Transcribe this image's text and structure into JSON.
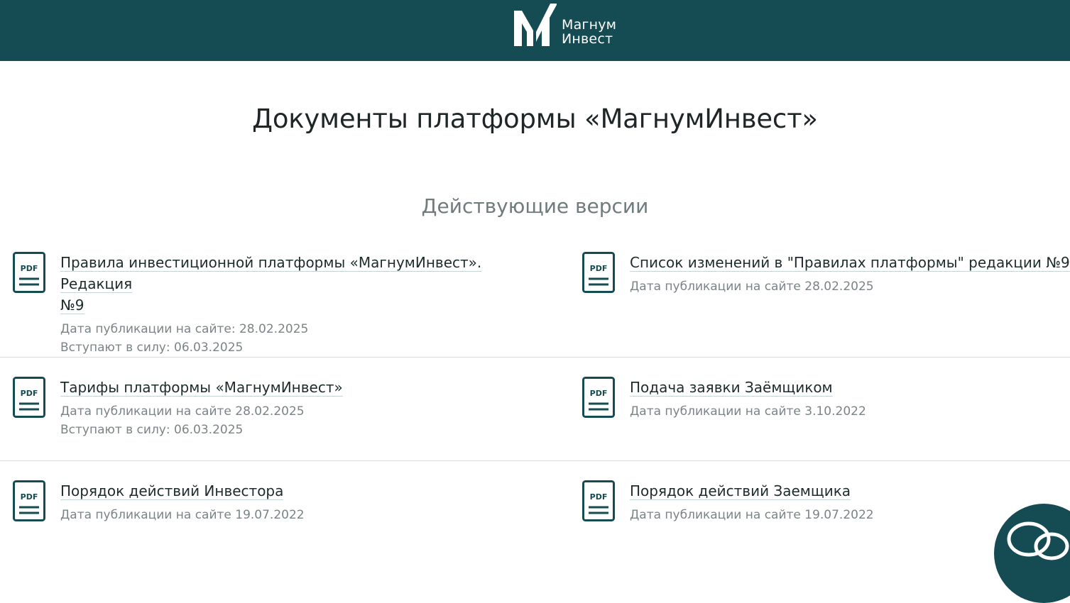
{
  "header": {
    "logo_line1": "Магнум",
    "logo_line2": "Инвест",
    "logo_icon": "m-logo-icon",
    "bg_color": "#154b52"
  },
  "page_title": "Документы платформы «МагнумИнвест»",
  "section_title": "Действующие версии",
  "pdf_icon_label": "PDF",
  "documents": [
    {
      "title_line1": "Правила инвестиционной платформы «МагнумИнвест». Редакция",
      "title_line2": "№9",
      "meta": [
        "Дата публикации на сайте: 28.02.2025",
        "Вступают в силу: 06.03.2025"
      ]
    },
    {
      "title_line1": "Список изменений в \"Правилах платформы\" редакции №9",
      "meta": [
        "Дата публикации на сайте 28.02.2025"
      ]
    },
    {
      "title_line1": "Тарифы платформы «МагнумИнвест»",
      "meta": [
        "Дата публикации на сайте 28.02.2025",
        "Вступают в силу: 06.03.2025"
      ]
    },
    {
      "title_line1": "Подача заявки Заёмщиком",
      "meta": [
        "Дата публикации на сайте 3.10.2022"
      ]
    },
    {
      "title_line1": "Порядок действий Инвестора",
      "meta": [
        "Дата публикации на сайте 19.07.2022"
      ]
    },
    {
      "title_line1": "Порядок действий Заемщика",
      "meta": [
        "Дата публикации на сайте 19.07.2022"
      ]
    }
  ],
  "chat_icon": "chat-bubble-icon"
}
